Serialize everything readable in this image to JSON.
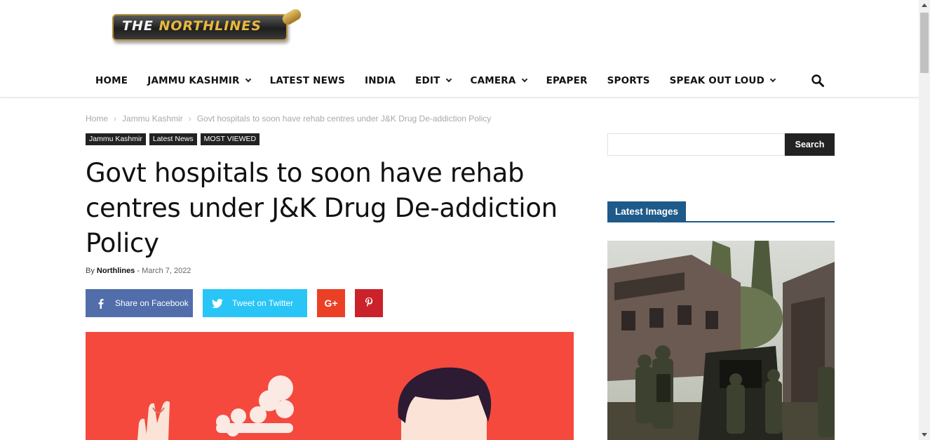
{
  "header": {
    "logo": {
      "text_the": "THE",
      "text_name": "NORTHLINES"
    },
    "nav": [
      {
        "label": "HOME",
        "dropdown": false
      },
      {
        "label": "JAMMU KASHMIR",
        "dropdown": true
      },
      {
        "label": "LATEST NEWS",
        "dropdown": false
      },
      {
        "label": "INDIA",
        "dropdown": false
      },
      {
        "label": "EDIT",
        "dropdown": true
      },
      {
        "label": "CAMERA",
        "dropdown": true
      },
      {
        "label": "EPAPER",
        "dropdown": false
      },
      {
        "label": "SPORTS",
        "dropdown": false
      },
      {
        "label": "SPEAK OUT LOUD",
        "dropdown": true
      }
    ],
    "search_icon": "search-icon"
  },
  "breadcrumb": {
    "home": "Home",
    "section": "Jammu Kashmir",
    "current": "Govt hospitals to soon have rehab centres under J&K Drug De-addiction Policy",
    "separator": "›"
  },
  "article": {
    "categories": [
      "Jammu Kashmir",
      "Latest News",
      "MOST VIEWED"
    ],
    "title": "Govt hospitals to soon have rehab centres under J&K Drug De-addiction Policy",
    "by_label": "By",
    "author": "Northlines",
    "date_sep": "-",
    "date": "March 7, 2022",
    "share": {
      "facebook": "Share on Facebook",
      "twitter": "Tweet on Twitter",
      "gplus_icon": "G+",
      "pinterest_icon": "P"
    }
  },
  "sidebar": {
    "search_placeholder": "",
    "search_button": "Search",
    "latest_images_title": "Latest Images"
  },
  "colors": {
    "facebook": "#516eab",
    "twitter": "#29c5f6",
    "gplus": "#eb4026",
    "pinterest": "#ca212a",
    "accent_blue": "#1e5a8a",
    "feature_bg": "#f5493e"
  }
}
